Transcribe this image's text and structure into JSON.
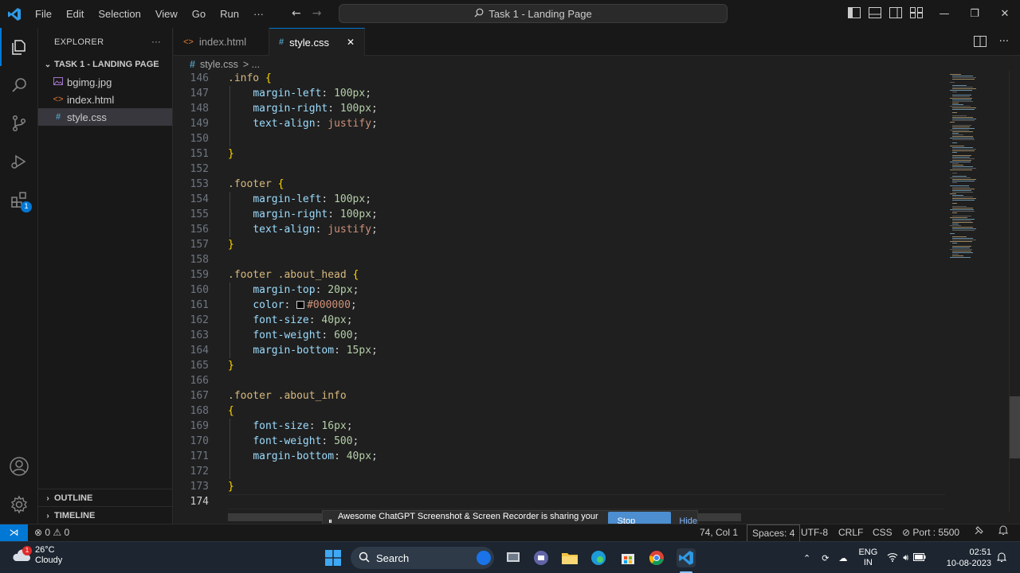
{
  "titlebar": {
    "menu": [
      "File",
      "Edit",
      "Selection",
      "View",
      "Go",
      "Run",
      "···"
    ],
    "command_center": "Task 1 - Landing Page"
  },
  "sidebar": {
    "header": "EXPLORER",
    "header_more": "···",
    "folder": "TASK 1 - LANDING PAGE",
    "files": [
      {
        "name": "bgimg.jpg",
        "icon": "image-file-icon"
      },
      {
        "name": "index.html",
        "icon": "html-file-icon"
      },
      {
        "name": "style.css",
        "icon": "css-file-icon",
        "active": true
      }
    ],
    "outline": "OUTLINE",
    "timeline": "TIMELINE"
  },
  "tabs": [
    {
      "label": "index.html",
      "icon": "<>",
      "active": false
    },
    {
      "label": "style.css",
      "icon": "#",
      "active": true
    }
  ],
  "close_glyph": "✕",
  "breadcrumb": {
    "file": "style.css",
    "rest": "> ..."
  },
  "editor": {
    "lines": [
      {
        "n": "146",
        "t": [
          [
            "sel",
            ".info "
          ],
          [
            "brace",
            "{"
          ]
        ]
      },
      {
        "n": "147",
        "t": [
          [
            "ws",
            "    "
          ],
          [
            "prop",
            "margin-left"
          ],
          [
            "punct",
            ": "
          ],
          [
            "num",
            "100px"
          ],
          [
            "punct",
            ";"
          ]
        ]
      },
      {
        "n": "148",
        "t": [
          [
            "ws",
            "    "
          ],
          [
            "prop",
            "margin-right"
          ],
          [
            "punct",
            ": "
          ],
          [
            "num",
            "100px"
          ],
          [
            "punct",
            ";"
          ]
        ]
      },
      {
        "n": "149",
        "t": [
          [
            "ws",
            "    "
          ],
          [
            "prop",
            "text-align"
          ],
          [
            "punct",
            ": "
          ],
          [
            "val",
            "justify"
          ],
          [
            "punct",
            ";"
          ]
        ]
      },
      {
        "n": "150",
        "t": []
      },
      {
        "n": "151",
        "t": [
          [
            "brace",
            "}"
          ]
        ]
      },
      {
        "n": "152",
        "t": []
      },
      {
        "n": "153",
        "t": [
          [
            "sel",
            ".footer "
          ],
          [
            "brace",
            "{"
          ]
        ]
      },
      {
        "n": "154",
        "t": [
          [
            "ws",
            "    "
          ],
          [
            "prop",
            "margin-left"
          ],
          [
            "punct",
            ": "
          ],
          [
            "num",
            "100px"
          ],
          [
            "punct",
            ";"
          ]
        ]
      },
      {
        "n": "155",
        "t": [
          [
            "ws",
            "    "
          ],
          [
            "prop",
            "margin-right"
          ],
          [
            "punct",
            ": "
          ],
          [
            "num",
            "100px"
          ],
          [
            "punct",
            ";"
          ]
        ]
      },
      {
        "n": "156",
        "t": [
          [
            "ws",
            "    "
          ],
          [
            "prop",
            "text-align"
          ],
          [
            "punct",
            ": "
          ],
          [
            "val",
            "justify"
          ],
          [
            "punct",
            ";"
          ]
        ]
      },
      {
        "n": "157",
        "t": [
          [
            "brace",
            "}"
          ]
        ]
      },
      {
        "n": "158",
        "t": []
      },
      {
        "n": "159",
        "t": [
          [
            "sel",
            ".footer .about_head "
          ],
          [
            "brace",
            "{"
          ]
        ]
      },
      {
        "n": "160",
        "t": [
          [
            "ws",
            "    "
          ],
          [
            "prop",
            "margin-top"
          ],
          [
            "punct",
            ": "
          ],
          [
            "num",
            "20px"
          ],
          [
            "punct",
            ";"
          ]
        ]
      },
      {
        "n": "161",
        "t": [
          [
            "ws",
            "    "
          ],
          [
            "prop",
            "color"
          ],
          [
            "punct",
            ": "
          ],
          [
            "swatch",
            ""
          ],
          [
            "val",
            "#000000"
          ],
          [
            "punct",
            ";"
          ]
        ]
      },
      {
        "n": "162",
        "t": [
          [
            "ws",
            "    "
          ],
          [
            "prop",
            "font-size"
          ],
          [
            "punct",
            ": "
          ],
          [
            "num",
            "40px"
          ],
          [
            "punct",
            ";"
          ]
        ]
      },
      {
        "n": "163",
        "t": [
          [
            "ws",
            "    "
          ],
          [
            "prop",
            "font-weight"
          ],
          [
            "punct",
            ": "
          ],
          [
            "num",
            "600"
          ],
          [
            "punct",
            ";"
          ]
        ]
      },
      {
        "n": "164",
        "t": [
          [
            "ws",
            "    "
          ],
          [
            "prop",
            "margin-bottom"
          ],
          [
            "punct",
            ": "
          ],
          [
            "num",
            "15px"
          ],
          [
            "punct",
            ";"
          ]
        ]
      },
      {
        "n": "165",
        "t": [
          [
            "brace",
            "}"
          ]
        ]
      },
      {
        "n": "166",
        "t": []
      },
      {
        "n": "167",
        "t": [
          [
            "sel",
            ".footer .about_info"
          ]
        ]
      },
      {
        "n": "168",
        "t": [
          [
            "brace",
            "{"
          ]
        ]
      },
      {
        "n": "169",
        "t": [
          [
            "ws",
            "    "
          ],
          [
            "prop",
            "font-size"
          ],
          [
            "punct",
            ": "
          ],
          [
            "num",
            "16px"
          ],
          [
            "punct",
            ";"
          ]
        ]
      },
      {
        "n": "170",
        "t": [
          [
            "ws",
            "    "
          ],
          [
            "prop",
            "font-weight"
          ],
          [
            "punct",
            ": "
          ],
          [
            "num",
            "500"
          ],
          [
            "punct",
            ";"
          ]
        ]
      },
      {
        "n": "171",
        "t": [
          [
            "ws",
            "    "
          ],
          [
            "prop",
            "margin-bottom"
          ],
          [
            "punct",
            ": "
          ],
          [
            "num",
            "40px"
          ],
          [
            "punct",
            ";"
          ]
        ]
      },
      {
        "n": "172",
        "t": []
      },
      {
        "n": "173",
        "t": [
          [
            "brace",
            "}"
          ]
        ]
      },
      {
        "n": "174",
        "t": [],
        "current": true
      }
    ]
  },
  "share_banner": {
    "pause_glyph": "⏸",
    "text": "Awesome ChatGPT Screenshot & Screen Recorder is sharing your screen.",
    "stop": "Stop sharing",
    "hide": "Hide"
  },
  "statusbar": {
    "remote": "⋊",
    "problems": "⊗ 0 ⚠ 0",
    "position": "74, Col 1",
    "spaces": "Spaces: 4",
    "encoding": "UTF-8",
    "eol": "CRLF",
    "language": "CSS",
    "port": "⊘ Port : 5500"
  },
  "taskbar": {
    "weather_temp": "26°C",
    "weather_desc": "Cloudy",
    "weather_badge": "1",
    "search": "Search",
    "lang_top": "ENG",
    "lang_bottom": "IN",
    "time": "02:51",
    "date": "10-08-2023"
  },
  "activity_badge": "1",
  "colors": {
    "accent": "#0078d4",
    "editor_bg": "#1f1f1f",
    "chrome_bg": "#181818"
  }
}
